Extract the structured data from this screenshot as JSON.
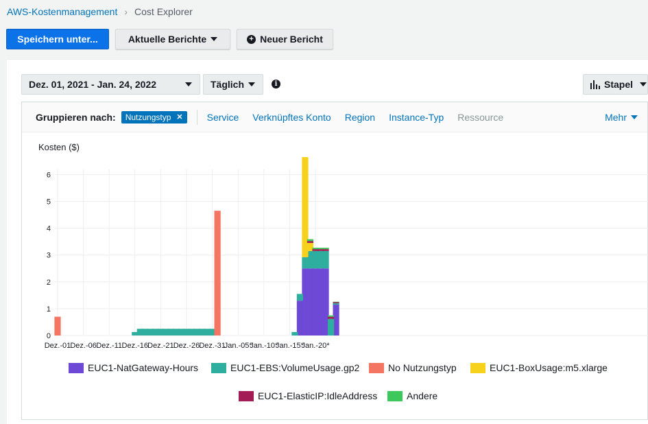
{
  "breadcrumb": {
    "parent": "AWS-Kostenmanagement",
    "current": "Cost Explorer"
  },
  "toolbar": {
    "save_label": "Speichern unter...",
    "reports_label": "Aktuelle Berichte",
    "new_report_label": "Neuer Bericht"
  },
  "controls": {
    "date_range": "Dez. 01, 2021 - Jan. 24, 2022",
    "granularity": "Täglich",
    "chart_style": "Stapel"
  },
  "grouping": {
    "label": "Gruppieren nach:",
    "active_chip": "Nutzungstyp",
    "options": [
      "Service",
      "Verknüpftes Konto",
      "Region",
      "Instance-Typ",
      "Ressource"
    ],
    "more": "Mehr"
  },
  "colors": {
    "primary": "#0b72e7",
    "link": "#0073bb",
    "NatGateway": "#6d49d6",
    "EBS": "#2eae9e",
    "NoType": "#f47562",
    "BoxUsage": "#f7d21c",
    "ElasticIP": "#a31c55",
    "Other": "#3cc85a"
  },
  "chart_data": {
    "type": "bar",
    "stacked": true,
    "ylabel": "Kosten ($)",
    "ylim": [
      0,
      6.2
    ],
    "yticks": [
      0,
      1,
      2,
      3,
      4,
      5,
      6
    ],
    "grid": true,
    "x_tick_labels": [
      "Dez.-01",
      "Dez.-06",
      "Dez.-11",
      "Dez.-16",
      "Dez.-21",
      "Dez.-26",
      "Dez.-31",
      "Jan.-05*",
      "Jan.-10*",
      "Jan.-15*",
      "Jan.-20*"
    ],
    "num_days": 55,
    "series": [
      {
        "name": "EUC1-NatGateway-Hours",
        "color": "#6d49d6",
        "points": [
          [
            47,
            1.3
          ],
          [
            48,
            2.5
          ],
          [
            49,
            2.5
          ],
          [
            50,
            2.5
          ],
          [
            51,
            2.5
          ],
          [
            52,
            2.5
          ],
          [
            54,
            1.15
          ]
        ]
      },
      {
        "name": "EUC1-EBS:VolumeUsage.gp2",
        "color": "#2eae9e",
        "points": [
          [
            15,
            0.13
          ],
          [
            16,
            0.25
          ],
          [
            17,
            0.25
          ],
          [
            18,
            0.25
          ],
          [
            19,
            0.25
          ],
          [
            20,
            0.25
          ],
          [
            21,
            0.25
          ],
          [
            22,
            0.25
          ],
          [
            23,
            0.25
          ],
          [
            24,
            0.25
          ],
          [
            25,
            0.25
          ],
          [
            26,
            0.25
          ],
          [
            27,
            0.25
          ],
          [
            28,
            0.25
          ],
          [
            29,
            0.25
          ],
          [
            30,
            0.25
          ],
          [
            46,
            0.13
          ],
          [
            47,
            0.25
          ],
          [
            48,
            0.42
          ],
          [
            49,
            0.65
          ],
          [
            50,
            0.65
          ],
          [
            51,
            0.65
          ],
          [
            52,
            0.65
          ],
          [
            53,
            0.62
          ],
          [
            54,
            0.05
          ]
        ]
      },
      {
        "name": "No Nutzungstyp",
        "color": "#f47562",
        "points": [
          [
            0,
            0.7
          ],
          [
            31,
            4.65
          ]
        ]
      },
      {
        "name": "EUC1-BoxUsage:m5.xlarge",
        "color": "#f7d21c",
        "points": [
          [
            48,
            4.0
          ],
          [
            49,
            0.3
          ]
        ]
      },
      {
        "name": "EUC1-ElasticIP:IdleAddress",
        "color": "#a31c55",
        "points": [
          [
            48,
            0.05
          ],
          [
            49,
            0.07
          ],
          [
            50,
            0.07
          ],
          [
            51,
            0.07
          ],
          [
            52,
            0.07
          ],
          [
            53,
            0.08
          ],
          [
            54,
            0.04
          ]
        ]
      },
      {
        "name": "Andere",
        "color": "#3cc85a",
        "points": [
          [
            48,
            0.33
          ],
          [
            49,
            0.07
          ],
          [
            50,
            0.05
          ],
          [
            51,
            0.05
          ],
          [
            52,
            0.05
          ],
          [
            53,
            0.05
          ],
          [
            54,
            0.02
          ]
        ]
      }
    ]
  }
}
